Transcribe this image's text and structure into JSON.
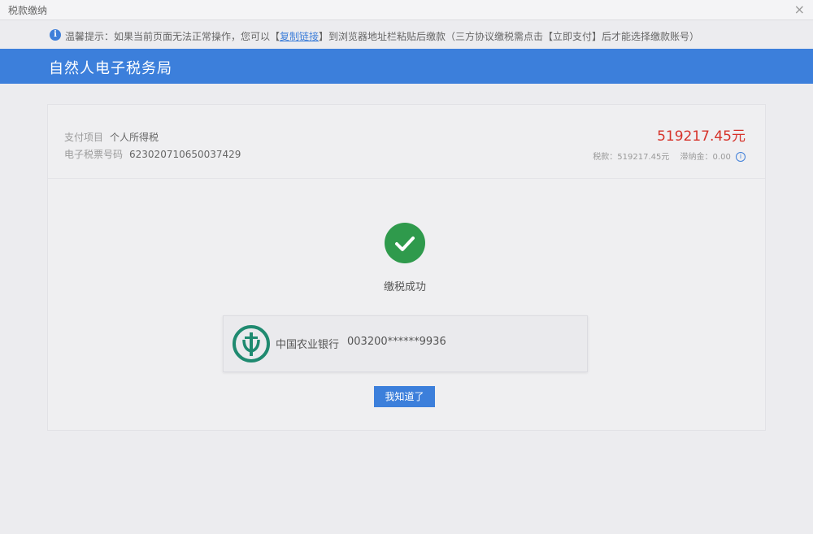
{
  "window": {
    "title": "税款缴纳",
    "close_glyph": "×"
  },
  "notice": {
    "icon": "i",
    "prefix": "温馨提示：如果当前页面无法正常操作，您可以【",
    "link": "复制链接",
    "suffix": "】到浏览器地址栏粘贴后缴款（三方协议缴税需点击【立即支付】后才能选择缴款账号）"
  },
  "header": {
    "brand": "自然人电子税务局"
  },
  "payment": {
    "item_label": "支付项目",
    "item_value": "个人所得税",
    "ticket_label": "电子税票号码",
    "ticket_value": "623020710650037429",
    "amount": "519217.45元",
    "tax_label": "税款：",
    "tax_value": "519217.45元",
    "late_fee_label": "滞纳金：",
    "late_fee_value": "0.00",
    "info_glyph": "i"
  },
  "result": {
    "status_text": "缴税成功"
  },
  "bank": {
    "name": "中国农业银行",
    "account": "003200******9936"
  },
  "actions": {
    "ok_label": "我知道了"
  },
  "colors": {
    "accent": "#3c7fdb",
    "success": "#2f9a4c",
    "amount": "#d6332a",
    "bank_logo": "#1f8a70"
  },
  "icons": {
    "info": "info-icon",
    "success": "check-circle-icon",
    "bank_logo": "abc-bank-logo-icon",
    "close": "close-icon"
  }
}
